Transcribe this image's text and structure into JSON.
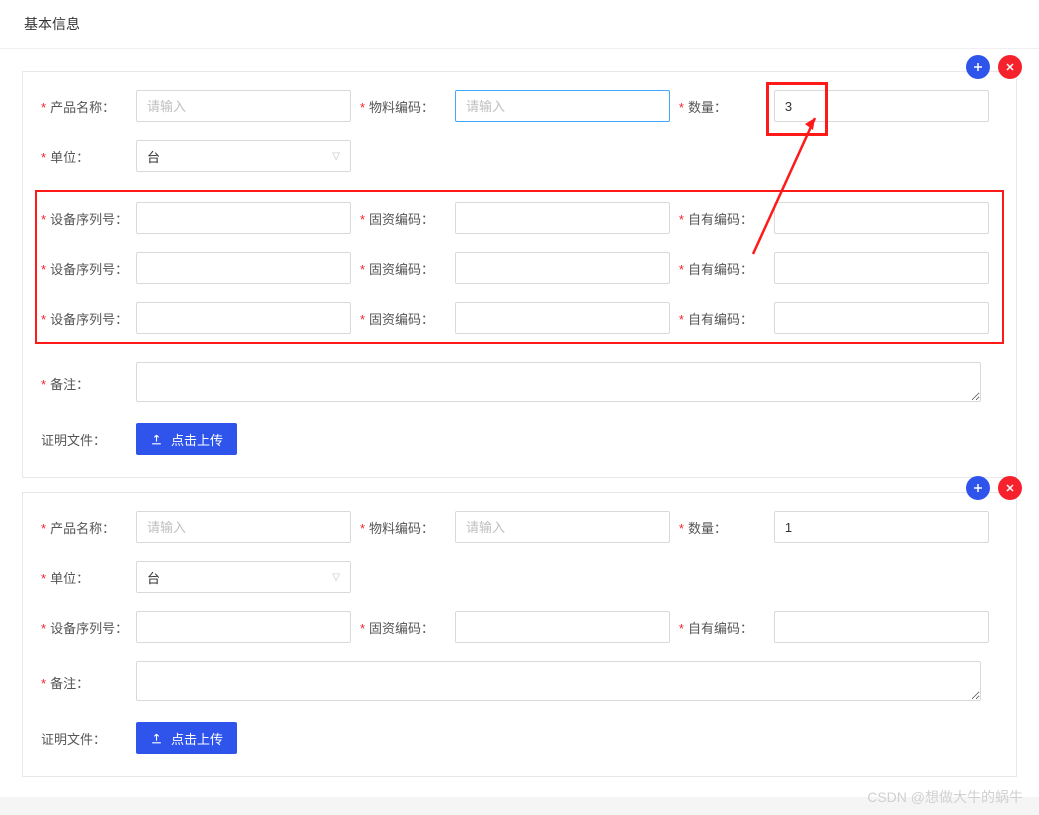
{
  "header": {
    "title": "基本信息"
  },
  "labels": {
    "product_name": "产品名称：",
    "material_code": "物料编码：",
    "quantity": "数量：",
    "unit": "单位：",
    "device_serial": "设备序列号：",
    "asset_code": "固资编码：",
    "own_code": "自有编码：",
    "remark": "备注：",
    "attachment": "证明文件："
  },
  "placeholders": {
    "input": "请输入"
  },
  "options": {
    "unit_selected": "台"
  },
  "buttons": {
    "upload": "点击上传"
  },
  "cards": [
    {
      "product_name": "",
      "material_code": "",
      "quantity": "3",
      "unit": "台",
      "rows": [
        {
          "device_serial": "",
          "asset_code": "",
          "own_code": ""
        },
        {
          "device_serial": "",
          "asset_code": "",
          "own_code": ""
        },
        {
          "device_serial": "",
          "asset_code": "",
          "own_code": ""
        }
      ],
      "remark": ""
    },
    {
      "product_name": "",
      "material_code": "",
      "quantity": "1",
      "unit": "台",
      "rows": [
        {
          "device_serial": "",
          "asset_code": "",
          "own_code": ""
        }
      ],
      "remark": ""
    }
  ],
  "watermark": "CSDN @想做大牛的蜗牛"
}
